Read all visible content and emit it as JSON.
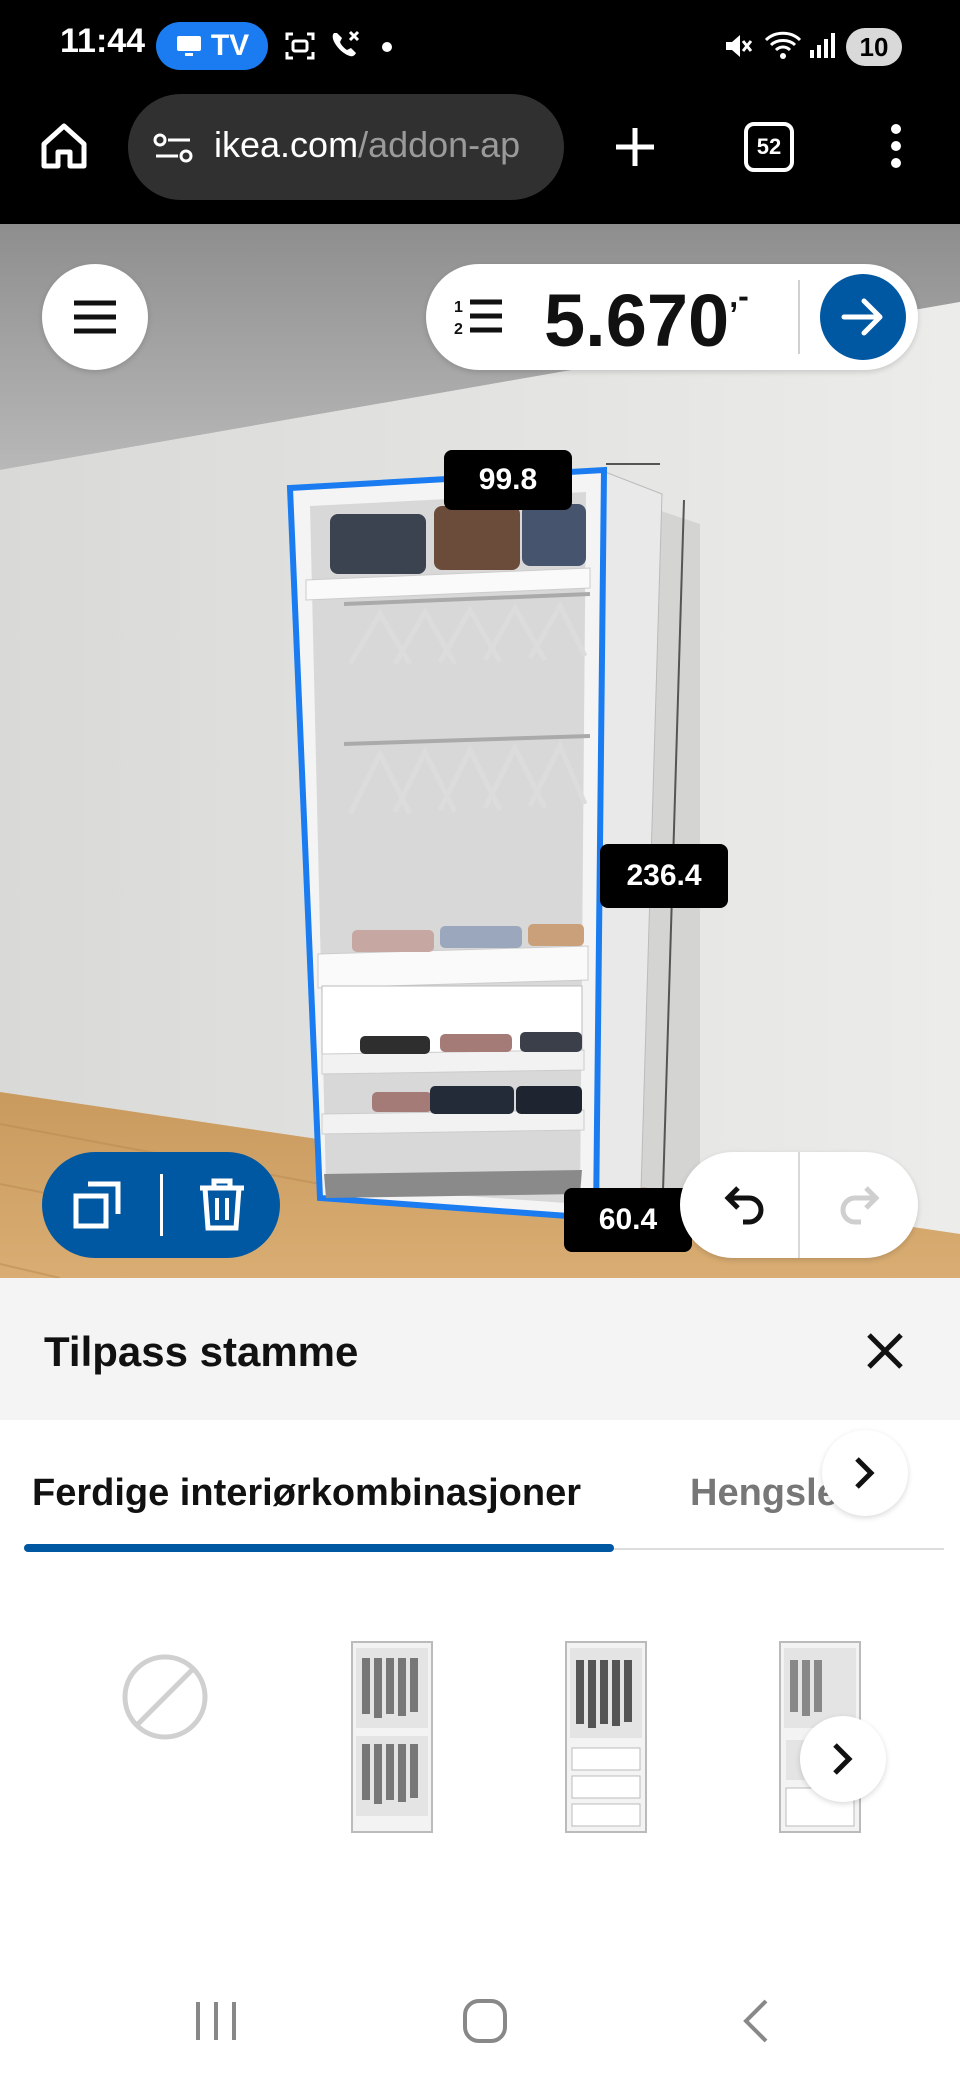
{
  "status_bar": {
    "time": "11:44",
    "tv_label": "TV",
    "battery": "10",
    "icons": [
      "screen-record-icon",
      "wifi-call-icon",
      "dot-icon",
      "mute-icon",
      "wifi-icon",
      "signal-icon"
    ]
  },
  "browser": {
    "url_domain": "ikea.com",
    "url_path": "/addon-ap",
    "tab_count": "52",
    "icons": [
      "home-icon",
      "site-settings-icon",
      "new-tab-icon",
      "tabs-icon",
      "more-icon"
    ]
  },
  "planner": {
    "price": "5.670",
    "price_suffix": ",-",
    "dimensions": {
      "width": "99.8",
      "height": "236.4",
      "depth": "60.4"
    },
    "colors": {
      "primary": "#0058a3",
      "selection_outline": "#1a7cf0"
    }
  },
  "panel": {
    "title": "Tilpass stamme",
    "tabs": [
      {
        "label": "Ferdige interiørkombinasjoner",
        "active": true
      },
      {
        "label": "Hengsle dø",
        "active": false
      }
    ],
    "thumbnails": [
      "none",
      "combination-1",
      "combination-2",
      "combination-3"
    ]
  }
}
